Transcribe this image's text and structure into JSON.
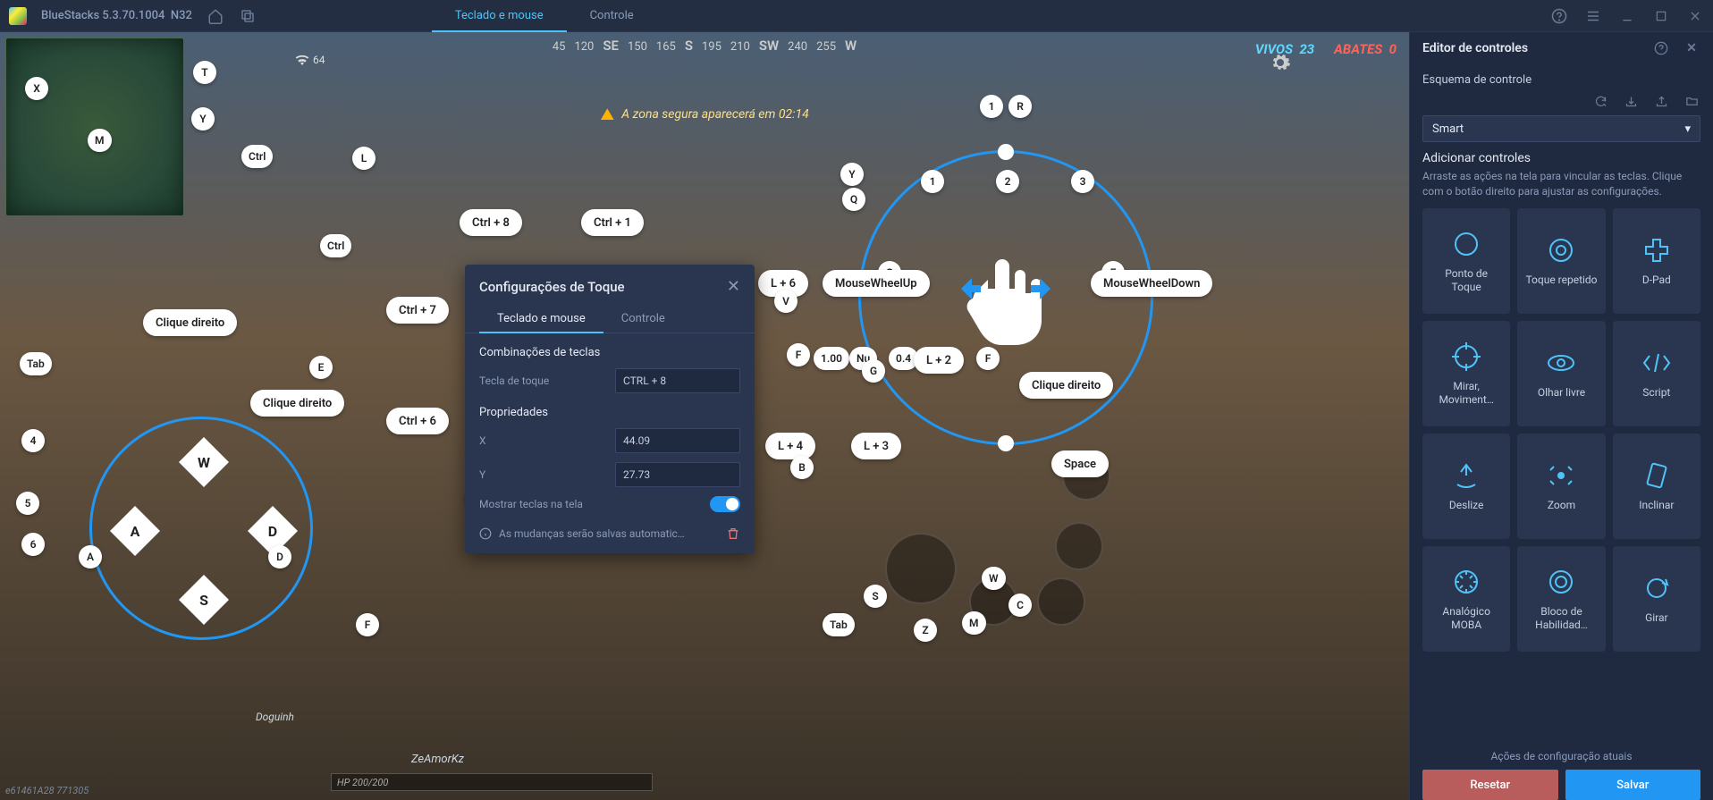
{
  "titlebar": {
    "app": "BlueStacks",
    "version": "5.3.70.1004",
    "build": "N32",
    "tabs": {
      "keyboard": "Teclado e mouse",
      "controller": "Controle"
    }
  },
  "sidebar": {
    "title": "Editor de controles",
    "scheme_label": "Esquema de controle",
    "scheme_value": "Smart",
    "add_title": "Adicionar controles",
    "add_hint": "Arraste as ações na tela para vincular as teclas. Clique com o botão direito para ajustar as configurações.",
    "cards": [
      {
        "label": "Ponto de Toque",
        "icon": "tap"
      },
      {
        "label": "Toque repetido",
        "icon": "repeat"
      },
      {
        "label": "D-Pad",
        "icon": "dpad"
      },
      {
        "label": "Mirar, Moviment…",
        "icon": "aim"
      },
      {
        "label": "Olhar livre",
        "icon": "look"
      },
      {
        "label": "Script",
        "icon": "script"
      },
      {
        "label": "Deslize",
        "icon": "swipe"
      },
      {
        "label": "Zoom",
        "icon": "zoom"
      },
      {
        "label": "Inclinar",
        "icon": "tilt"
      },
      {
        "label": "Analógico MOBA",
        "icon": "moba"
      },
      {
        "label": "Bloco de Habilidad…",
        "icon": "skill"
      },
      {
        "label": "Girar",
        "icon": "rotate"
      }
    ],
    "footer_label": "Ações de configuração atuais",
    "reset": "Resetar",
    "save": "Salvar"
  },
  "popup": {
    "title": "Configurações de Toque",
    "tab_kb": "Teclado e mouse",
    "tab_ctrl": "Controle",
    "sect_keys": "Combinações de teclas",
    "touch_key_label": "Tecla de toque",
    "touch_key_value": "CTRL + 8",
    "sect_props": "Propriedades",
    "x_label": "X",
    "x_value": "44.09",
    "y_label": "Y",
    "y_value": "27.73",
    "show_keys": "Mostrar teclas na tela",
    "auto_save": "As mudanças serão salvas automatic…"
  },
  "hud": {
    "wifi": "64",
    "compass": [
      "45",
      "120",
      "SE",
      "150",
      "165",
      "S",
      "195",
      "210",
      "SW",
      "240",
      "255",
      "W"
    ],
    "vivos_label": "VIVOS",
    "vivos_val": "23",
    "abates_label": "ABATES",
    "abates_val": "0",
    "zone": "A zona segura aparecerá em 02:14",
    "hp": "HP 200/200",
    "player1": "ZeAmorKz",
    "player2": "Doguinh",
    "session": "e61461A28 771305"
  },
  "keys": {
    "x": "X",
    "t": "T",
    "y": "Y",
    "m": "M",
    "ctrl": "Ctrl",
    "l": "L",
    "ctrl8": "Ctrl + 8",
    "ctrl1": "Ctrl + 1",
    "ctrl7": "Ctrl + 7",
    "ctrl6": "Ctrl + 6",
    "clique": "Clique direito",
    "tab": "Tab",
    "e": "E",
    "num4": "4",
    "num5": "5",
    "num6": "6",
    "a": "A",
    "d": "D",
    "w": "W",
    "s": "S",
    "q": "Q",
    "f": "F",
    "r": "R",
    "g": "G",
    "v": "V",
    "b": "B",
    "c": "C",
    "z": "Z",
    "space": "Space",
    "mwu": "MouseWheelUp",
    "mwd": "MouseWheelDown",
    "n1": "1",
    "n2": "2",
    "n3": "3",
    "l6": "L + 6",
    "l4": "L + 4",
    "l3": "L + 3",
    "l2": "L + 2",
    "nu": "Nu",
    "val1": "1.00",
    "val04": "0.4"
  }
}
